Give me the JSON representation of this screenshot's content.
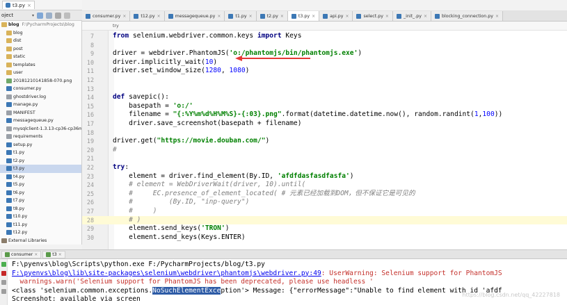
{
  "top_tab": {
    "label": "t3.py"
  },
  "project": {
    "dropdown": "oject"
  },
  "tree": [
    {
      "label": "blog",
      "path": "F:\\PycharmProjects\\blog",
      "kind": "folder",
      "indent": 0,
      "bold": true
    },
    {
      "label": "blog",
      "kind": "folder",
      "indent": 1
    },
    {
      "label": "dist",
      "kind": "folder",
      "indent": 1
    },
    {
      "label": "post",
      "kind": "folder",
      "indent": 1
    },
    {
      "label": "static",
      "kind": "folder",
      "indent": 1
    },
    {
      "label": "templates",
      "kind": "folder",
      "indent": 1
    },
    {
      "label": "user",
      "kind": "folder",
      "indent": 1
    },
    {
      "label": "20181210141858-070.png",
      "kind": "img",
      "indent": 1
    },
    {
      "label": "consumer.py",
      "kind": "py",
      "indent": 1
    },
    {
      "label": "ghostdriver.log",
      "kind": "txt",
      "indent": 1
    },
    {
      "label": "manage.py",
      "kind": "py",
      "indent": 1
    },
    {
      "label": "MANIFEST",
      "kind": "txt",
      "indent": 1
    },
    {
      "label": "messagequeue.py",
      "kind": "py",
      "indent": 1
    },
    {
      "label": "mysqlclient-1.3.13-cp36-cp36m-w",
      "kind": "txt",
      "indent": 1
    },
    {
      "label": "requirements",
      "kind": "txt",
      "indent": 1
    },
    {
      "label": "setup.py",
      "kind": "py",
      "indent": 1
    },
    {
      "label": "t1.py",
      "kind": "py",
      "indent": 1
    },
    {
      "label": "t2.py",
      "kind": "py",
      "indent": 1
    },
    {
      "label": "t3.py",
      "kind": "py",
      "indent": 1,
      "selected": true
    },
    {
      "label": "t4.py",
      "kind": "py",
      "indent": 1
    },
    {
      "label": "t5.py",
      "kind": "py",
      "indent": 1
    },
    {
      "label": "t6.py",
      "kind": "py",
      "indent": 1
    },
    {
      "label": "t7.py",
      "kind": "py",
      "indent": 1
    },
    {
      "label": "t8.py",
      "kind": "py",
      "indent": 1
    },
    {
      "label": "t10.py",
      "kind": "py",
      "indent": 1
    },
    {
      "label": "t11.py",
      "kind": "py",
      "indent": 1
    },
    {
      "label": "t12.py",
      "kind": "py",
      "indent": 1
    },
    {
      "label": "External Libraries",
      "kind": "lib",
      "indent": 0
    }
  ],
  "editor_tabs": [
    {
      "label": "consumer.py"
    },
    {
      "label": "t12.py"
    },
    {
      "label": "messagequeue.py"
    },
    {
      "label": "t1.py"
    },
    {
      "label": "t2.py"
    },
    {
      "label": "t3.py",
      "active": true
    },
    {
      "label": "api.py"
    },
    {
      "label": "select.py"
    },
    {
      "label": "_init_.py"
    },
    {
      "label": "blocking_connection.py"
    }
  ],
  "breadcrumb": "try",
  "code": [
    {
      "n": "7",
      "html": "<span class=\"kw\">from</span> selenium.webdriver.common.keys <span class=\"kw\">import</span> Keys"
    },
    {
      "n": "8",
      "html": ""
    },
    {
      "n": "9",
      "html": "driver = webdriver.PhantomJS(<span class=\"str\">'o:/phantomjs/bin/phantomjs.exe'</span>)"
    },
    {
      "n": "10",
      "html": "driver.implicitly_wait(<span class=\"num\">10</span>)"
    },
    {
      "n": "11",
      "html": "driver.set_window_size(<span class=\"num\">1280</span>, <span class=\"num\">1080</span>)"
    },
    {
      "n": "12",
      "html": ""
    },
    {
      "n": "13",
      "html": ""
    },
    {
      "n": "14",
      "html": "<span class=\"kw\">def</span> savepic():"
    },
    {
      "n": "15",
      "html": "    basepath = <span class=\"str\">'o:/'</span>"
    },
    {
      "n": "16",
      "html": "    filename = <span class=\"str\">\"{:%Y%m%d%H%M%S}-{:03}.png\"</span>.format(datetime.datetime.now(), random.randint(<span class=\"num\">1</span>,<span class=\"num\">100</span>))"
    },
    {
      "n": "17",
      "html": "    driver.save_screenshot(basepath + filename)"
    },
    {
      "n": "18",
      "html": ""
    },
    {
      "n": "19",
      "html": "driver.get(<span class=\"str\">\"https://movie.douban.com/\"</span>)"
    },
    {
      "n": "20",
      "html": "<span class=\"cmt\">#</span>"
    },
    {
      "n": "21",
      "html": ""
    },
    {
      "n": "22",
      "html": "<span class=\"kw\">try</span>:"
    },
    {
      "n": "23",
      "html": "    element = driver.find_element(By.ID, <span class=\"str\">'afdfdasfasdfasfa'</span>)"
    },
    {
      "n": "24",
      "html": "    <span class=\"cmt\"># element = WebDriverWait(driver, 10).until(</span>"
    },
    {
      "n": "25",
      "html": "    <span class=\"cmt\">#     EC.presence_of_element_located( # 元素已经加载到DOM，但不保证它是可见的</span>"
    },
    {
      "n": "26",
      "html": "    <span class=\"cmt\">#         (By.ID, \"inp-query\")</span>"
    },
    {
      "n": "27",
      "html": "    <span class=\"cmt\">#     )</span>"
    },
    {
      "n": "28",
      "html": "    <span class=\"cmt\"># )</span>",
      "current": true
    },
    {
      "n": "29",
      "html": "    element.send_keys(<span class=\"str\">'TRON'</span>)"
    },
    {
      "n": "30",
      "html": "    element.send_keys(Keys.ENTER)"
    }
  ],
  "run_tabs": [
    {
      "label": "consumer"
    },
    {
      "label": "t3"
    }
  ],
  "output": [
    {
      "html": "F:\\pyenvs\\blog\\Scripts\\python.exe F:/PycharmProjects/blog/t3.py",
      "err": false
    },
    {
      "html": "<span class=\"lnk\">F:\\pyenvs\\blog\\lib\\site-packages\\selenium\\webdriver\\phantomjs\\webdriver.py:49</span>: UserWarning: Selenium support for PhantomJS",
      "err": true
    },
    {
      "html": "  warnings.warn('Selenium support for PhantomJS has been deprecated, please use headless '",
      "err": true
    },
    {
      "html": "&lt;class 'selenium.common.exceptions.<span class=\"hl\">NoSuchElementExce</span>ption'&gt; Message: {\"errorMessage\":\"Unable to find element with id 'afdf",
      "err": false
    },
    {
      "html": "Screenshot: available via screen",
      "err": false
    }
  ],
  "watermark": "https://blog.csdn.net/qq_42227818",
  "colors": {
    "keyword": "#000080",
    "string": "#008000",
    "error": "#c4302b",
    "selection": "#2d5ba6"
  }
}
